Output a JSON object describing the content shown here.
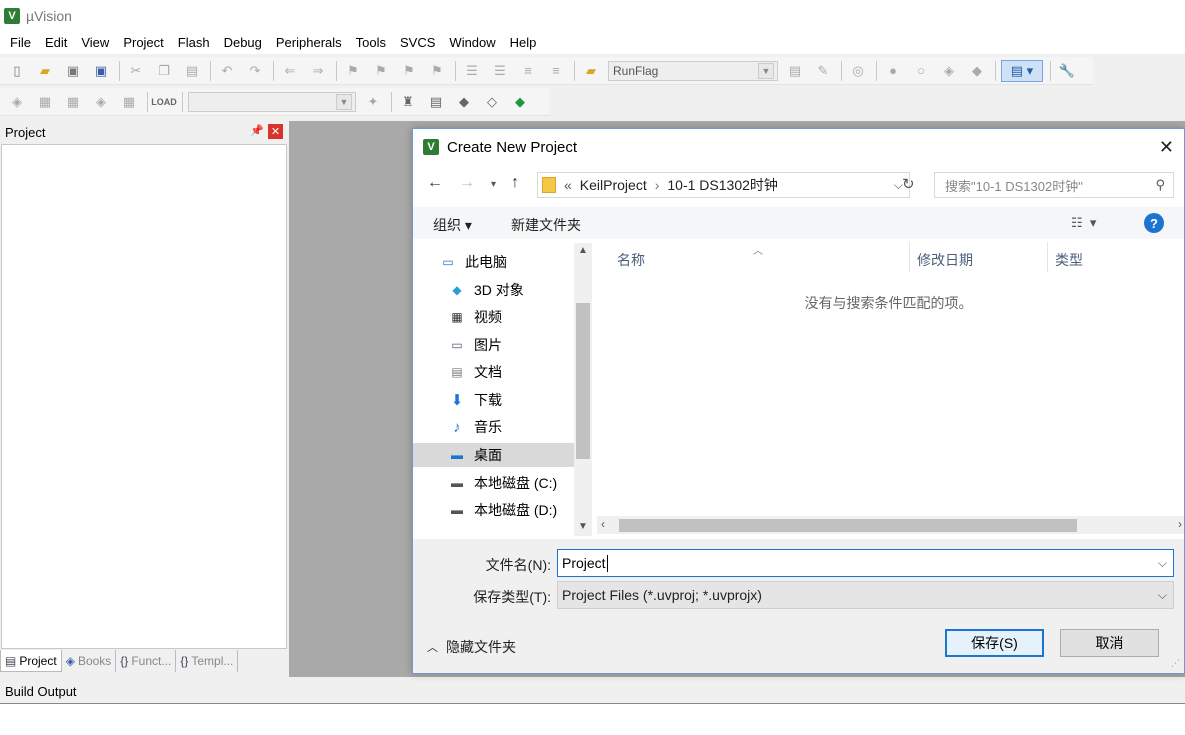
{
  "app": {
    "title": "µVision",
    "logo": "V"
  },
  "menu": [
    "File",
    "Edit",
    "View",
    "Project",
    "Flash",
    "Debug",
    "Peripherals",
    "Tools",
    "SVCS",
    "Window",
    "Help"
  ],
  "toolbar": {
    "target_combo": "RunFlag"
  },
  "project_pane": {
    "title": "Project",
    "tabs": [
      "Project",
      "Books",
      "Funct...",
      "Templ..."
    ]
  },
  "build_output": {
    "title": "Build Output"
  },
  "dialog": {
    "title": "Create New Project",
    "breadcrumb": {
      "prefix": "«",
      "items": [
        "KeilProject",
        "10-1 DS1302时钟"
      ]
    },
    "search_placeholder": "搜索\"10-1 DS1302时钟\"",
    "commands": {
      "organize": "组织 ▾",
      "new_folder": "新建文件夹"
    },
    "nav_items": [
      "此电脑",
      "3D 对象",
      "视频",
      "图片",
      "文档",
      "下载",
      "音乐",
      "桌面",
      "本地磁盘 (C:)",
      "本地磁盘 (D:)"
    ],
    "selected_nav": "桌面",
    "columns": [
      "名称",
      "修改日期",
      "类型"
    ],
    "empty_message": "没有与搜索条件匹配的项。",
    "filename_label": "文件名(N):",
    "filename_value": "Project",
    "filetype_label": "保存类型(T):",
    "filetype_value": "Project Files (*.uvproj; *.uvprojx)",
    "hide_folders": "隐藏文件夹",
    "save_button": "保存(S)",
    "cancel_button": "取消"
  },
  "colors": {
    "accent": "#1b75d0",
    "logo": "#2e7d32",
    "folder": "#f4c845"
  }
}
